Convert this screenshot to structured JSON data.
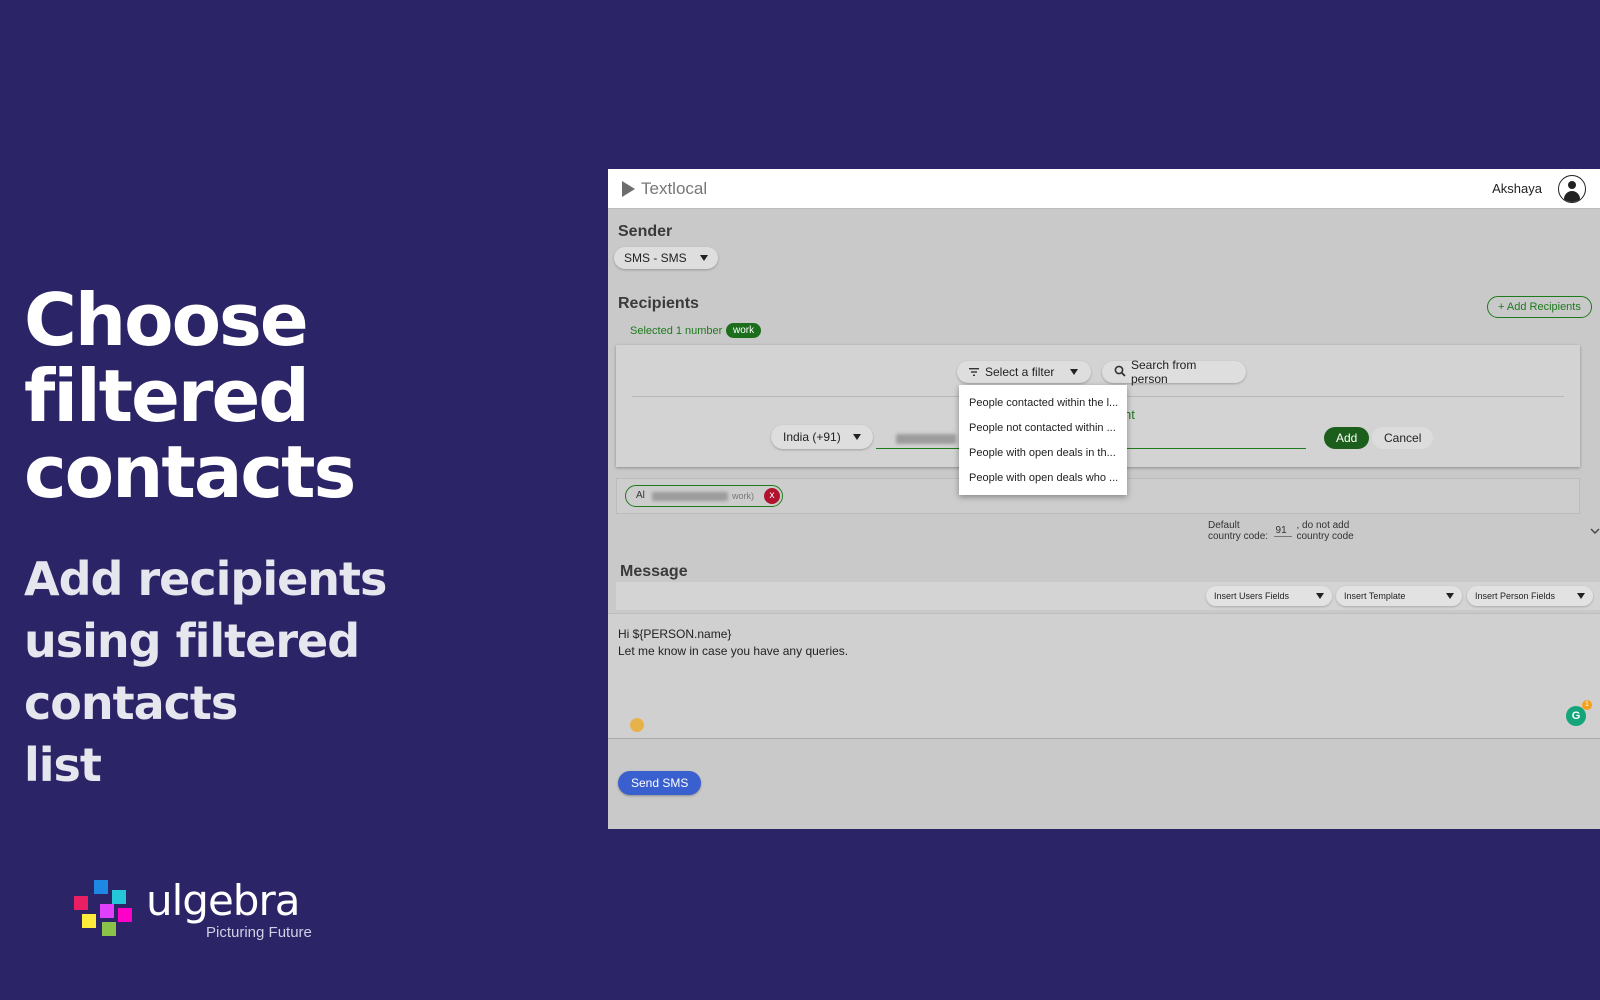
{
  "marketing": {
    "headline_line1": "Choose filtered",
    "headline_line2": "contacts",
    "sub_line1": "Add recipients",
    "sub_line2": "using filtered",
    "sub_line3": "contacts",
    "sub_line4": "list"
  },
  "logo": {
    "word": "ulgebra",
    "tagline": "Picturing Future"
  },
  "app": {
    "brand": "Textlocal",
    "user": "Akshaya",
    "sender": {
      "title": "Sender",
      "selected": "SMS - SMS"
    },
    "recipients": {
      "title": "Recipients",
      "selected_text": "Selected 1 number",
      "tag": "work",
      "add_button": "+ Add Recipients",
      "filter_button": "Select a filter",
      "search_button": "Search from person",
      "partial_label": "nt",
      "country": "India (+91)",
      "add": "Add",
      "cancel": "Cancel",
      "filter_options": [
        "People contacted within the l...",
        "People not contacted within ...",
        "People with open deals in th...",
        "People with open deals who ..."
      ],
      "chip_prefix": "Al",
      "chip_suffix": "work)",
      "chip_remove": "x"
    },
    "country_code": {
      "label": "Default country code:",
      "value": "91",
      "suffix": ", do not add country code"
    },
    "message": {
      "title": "Message",
      "insert_users": "Insert Users Fields",
      "insert_template": "Insert Template",
      "insert_person": "Insert Person Fields",
      "line1": "Hi ${PERSON.name}",
      "line2": "Let me know in case you have any queries.",
      "grammarly_count": "1"
    },
    "send_button": "Send SMS"
  },
  "colors": {
    "background": "#2b2466",
    "accent_green": "#1c6e1c",
    "send_blue": "#3a5fcf",
    "remove_red": "#b0142c"
  }
}
